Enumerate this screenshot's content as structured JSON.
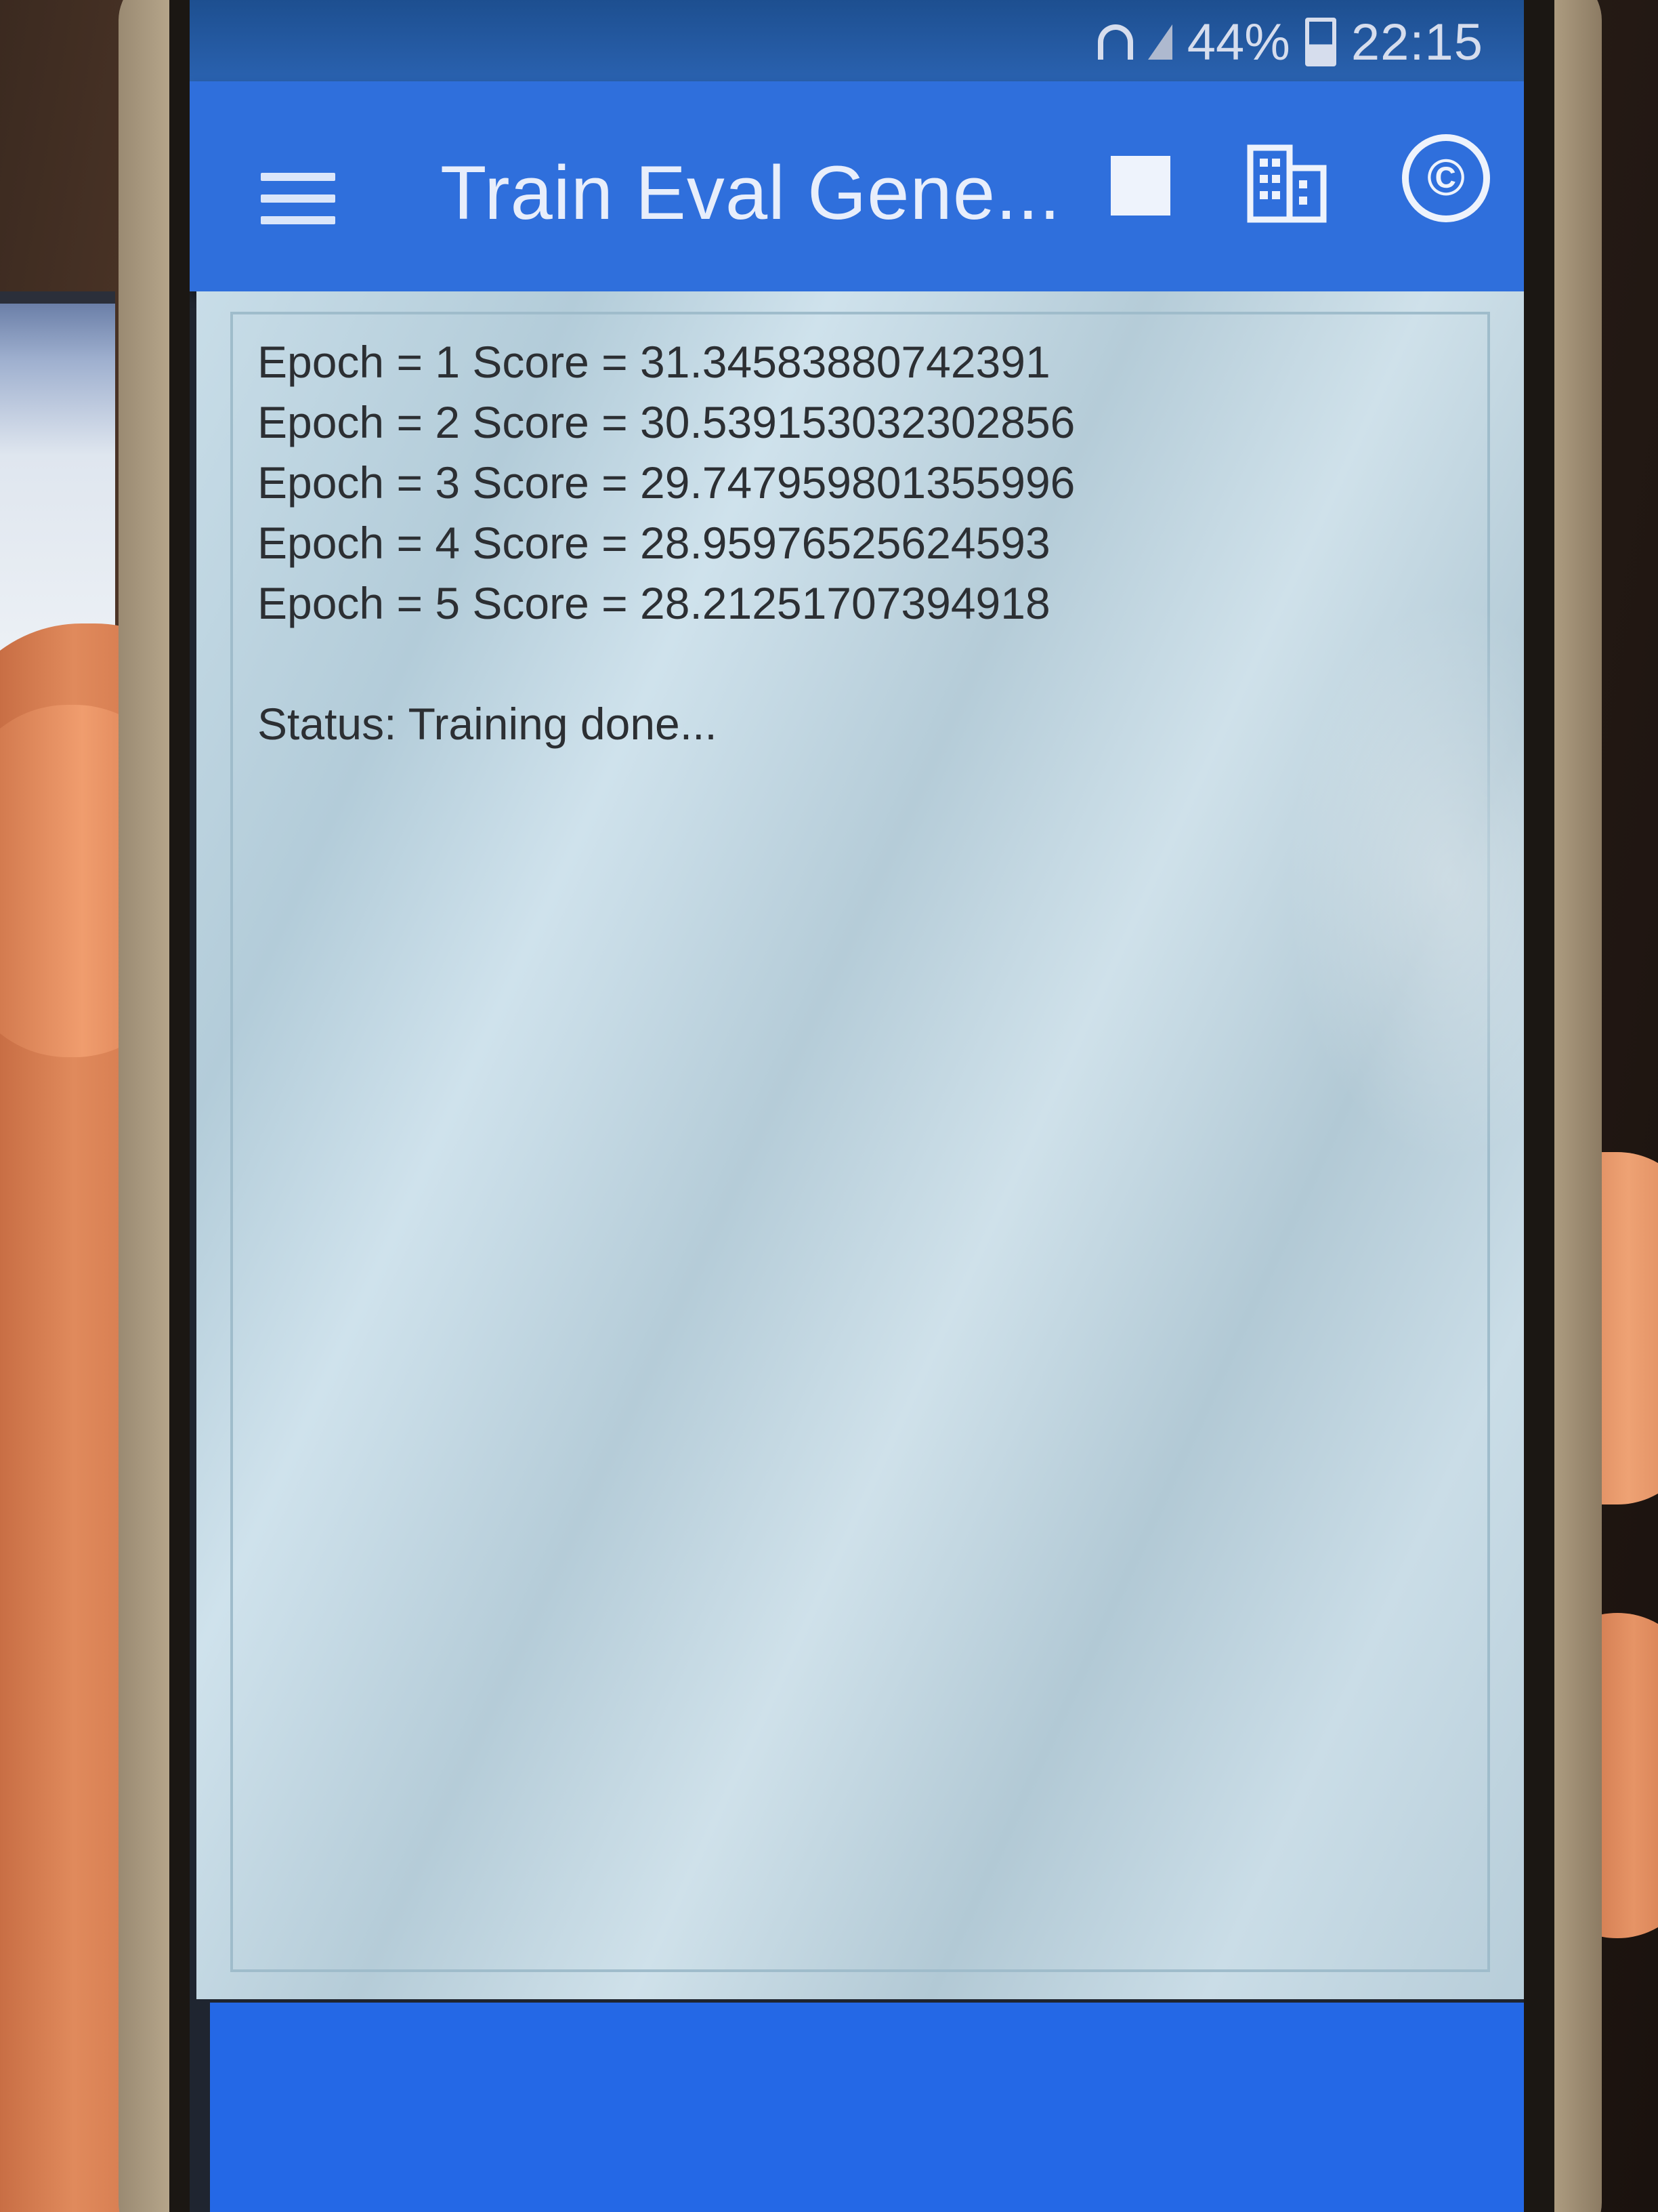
{
  "status_bar": {
    "battery": "44%",
    "time": "22:15"
  },
  "app_bar": {
    "title": "Train Eval Gene...",
    "icons": [
      "menu-icon",
      "stop-icon",
      "building-icon",
      "copyright-icon"
    ],
    "copyright_symbol": "©"
  },
  "log": {
    "lines": [
      "Epoch = 1 Score = 31.34583880742391",
      "Epoch = 2 Score = 30.539153032302856",
      "Epoch = 3 Score = 29.747959801355996",
      "Epoch = 4 Score = 28.95976525624593",
      "Epoch = 5 Score = 28.21251707394918"
    ],
    "status": "Status: Training done..."
  },
  "colors": {
    "app_bar": "#2f6fdc",
    "status_bar": "#2a62b0",
    "content_bg": "#c8dde8",
    "bottom_bar": "#2468e6",
    "text": "#2c2f33"
  }
}
